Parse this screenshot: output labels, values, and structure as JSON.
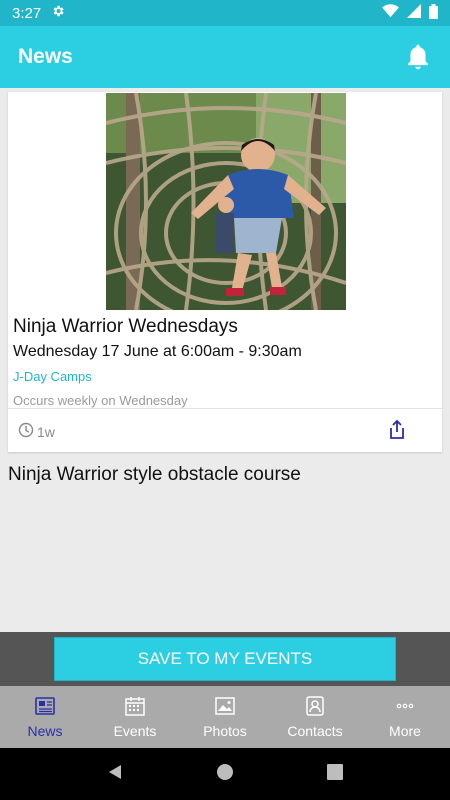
{
  "status_bar": {
    "time": "3:27"
  },
  "app_bar": {
    "title": "News"
  },
  "event": {
    "title": "Ninja Warrior Wednesdays",
    "datetime": "Wednesday 17 June at 6:00am - 9:30am",
    "category": "J-Day Camps",
    "recurrence": "Occurs weekly on Wednesday",
    "age": "1w",
    "description": "Ninja Warrior style obstacle course"
  },
  "save_button": {
    "label": "SAVE TO MY EVENTS"
  },
  "tabs": [
    {
      "label": "News",
      "icon": "news-icon",
      "active": true
    },
    {
      "label": "Events",
      "icon": "calendar-icon",
      "active": false
    },
    {
      "label": "Photos",
      "icon": "photo-icon",
      "active": false
    },
    {
      "label": "Contacts",
      "icon": "contact-icon",
      "active": false
    },
    {
      "label": "More",
      "icon": "more-dots-icon",
      "active": false
    }
  ],
  "colors": {
    "accent": "#2ccfe2",
    "status_bar": "#20b5c9",
    "tab_active": "#2a2fa8",
    "tab_bar": "#aaaaaa",
    "link": "#20b5c9"
  }
}
